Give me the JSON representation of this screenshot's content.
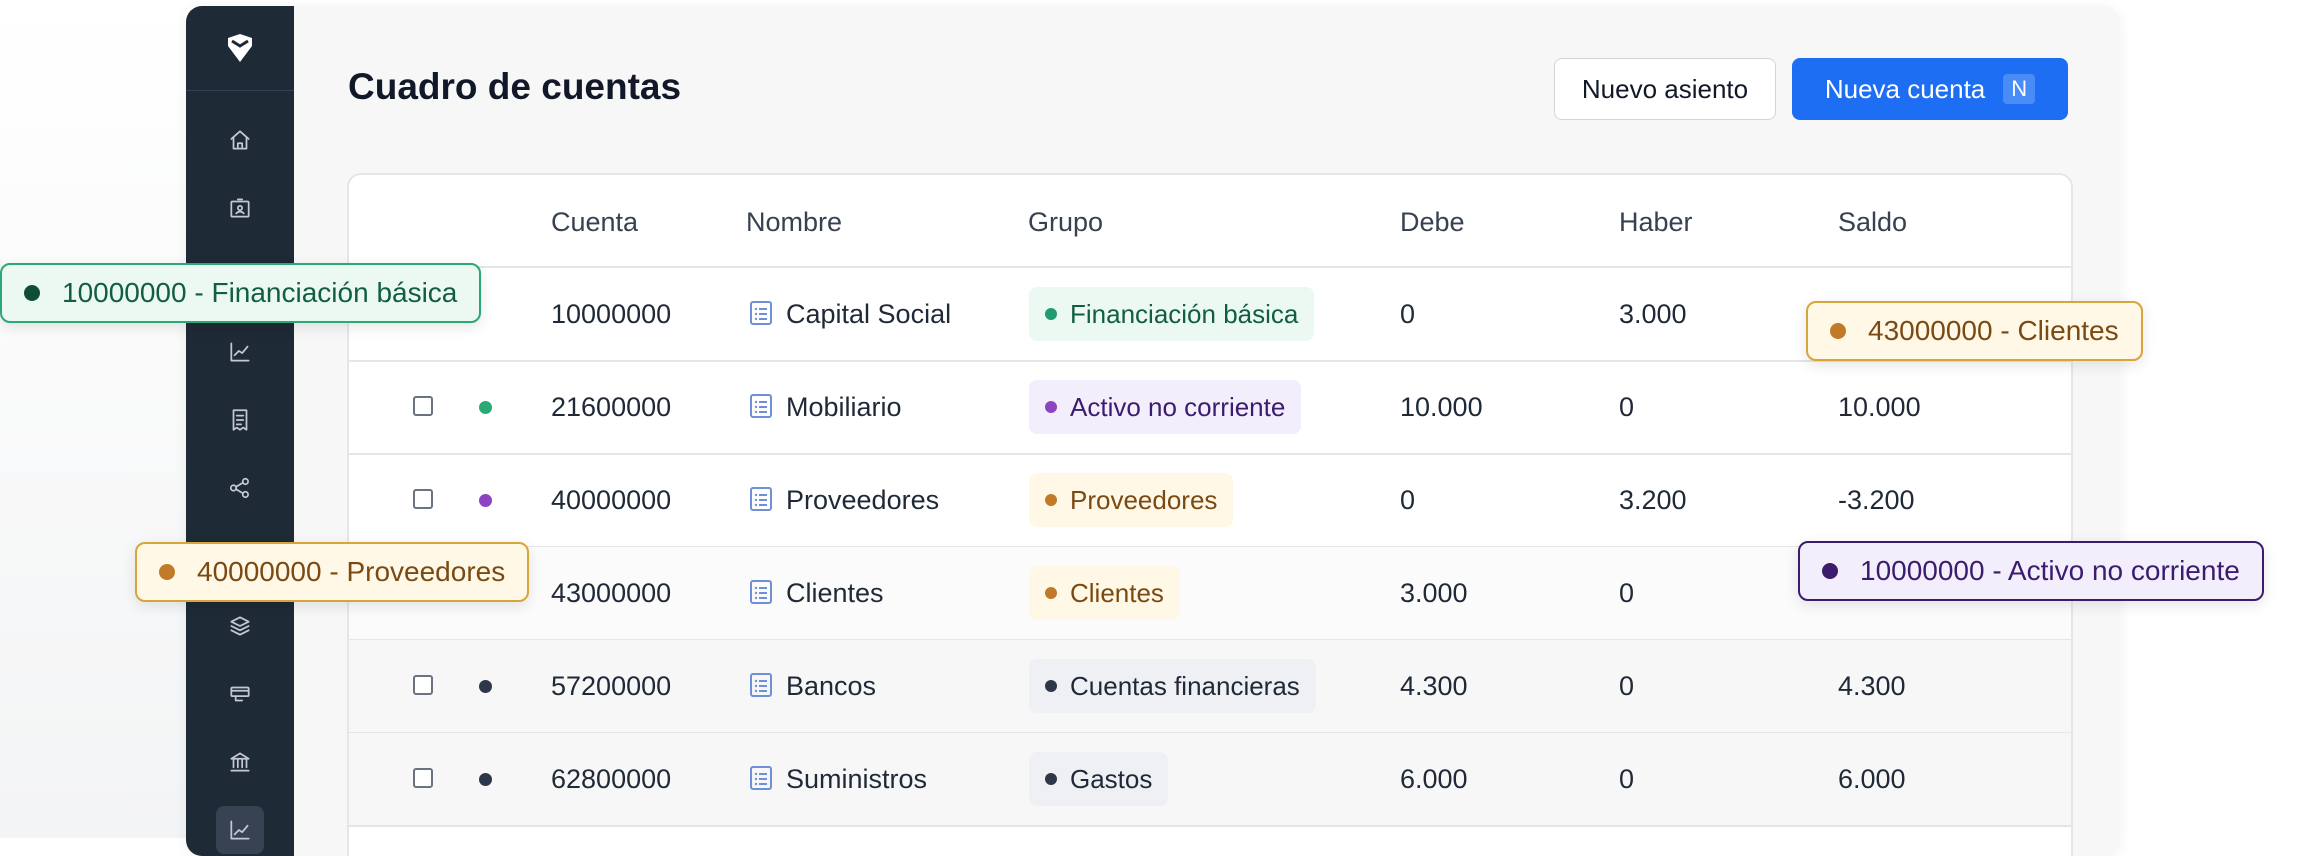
{
  "page": {
    "title": "Cuadro de cuentas",
    "secondary_button": "Nuevo asiento",
    "primary_button": "Nueva cuenta",
    "primary_button_shortcut": "N"
  },
  "sidebar": {
    "icons": [
      "logo-icon",
      "home-icon",
      "contact-card-icon",
      "chart-icon",
      "receipt-icon",
      "share-icon",
      "layers-icon",
      "cards-icon",
      "bank-icon",
      "trend-icon"
    ]
  },
  "table": {
    "columns": [
      "Cuenta",
      "Nombre",
      "Grupo",
      "Debe",
      "Haber",
      "Saldo"
    ],
    "rows": [
      {
        "cuenta": "10000000",
        "nombre": "Capital Social",
        "grupo": "Financiación básica",
        "debe": "0",
        "haber": "3.000",
        "saldo": "",
        "dot_color": "",
        "group_color": "green"
      },
      {
        "cuenta": "21600000",
        "nombre": "Mobiliario",
        "grupo": "Activo no corriente",
        "debe": "10.000",
        "haber": "0",
        "saldo": "10.000",
        "dot_color": "#2aa876",
        "group_color": "purple"
      },
      {
        "cuenta": "40000000",
        "nombre": "Proveedores",
        "grupo": "Proveedores",
        "debe": "0",
        "haber": "3.200",
        "saldo": "-3.200",
        "dot_color": "#8e44c2",
        "group_color": "amber"
      },
      {
        "cuenta": "43000000",
        "nombre": "Clientes",
        "grupo": "Clientes",
        "debe": "3.000",
        "haber": "0",
        "saldo": "",
        "dot_color": "",
        "group_color": "amber"
      },
      {
        "cuenta": "57200000",
        "nombre": "Bancos",
        "grupo": "Cuentas financieras",
        "debe": "4.300",
        "haber": "0",
        "saldo": "4.300",
        "dot_color": "#2d3748",
        "group_color": "gray"
      },
      {
        "cuenta": "62800000",
        "nombre": "Suministros",
        "grupo": "Gastos",
        "debe": "6.000",
        "haber": "0",
        "saldo": "6.000",
        "dot_color": "#2d3748",
        "group_color": "gray"
      }
    ]
  },
  "tooltips": [
    {
      "text": "10000000 - Financiación básica",
      "color": "green"
    },
    {
      "text": "43000000 - Clientes",
      "color": "amber"
    },
    {
      "text": "40000000 - Proveedores",
      "color": "amber"
    },
    {
      "text": "10000000 - Activo no corriente",
      "color": "purple"
    }
  ],
  "colors": {
    "green": {
      "bg": "#ecf9f3",
      "fg": "#115e42",
      "dot": "#1f9d6c",
      "border": "#2aa876"
    },
    "purple": {
      "bg": "#f3eefc",
      "fg": "#3b1c6e",
      "dot": "#8e44c2",
      "border": "#3b1c6e"
    },
    "amber": {
      "bg": "#fff8e6",
      "fg": "#7a4a12",
      "dot": "#c07a28",
      "border": "#d6a53c"
    },
    "gray": {
      "bg": "#eef0f3",
      "fg": "#1f2937",
      "dot": "#2d3748",
      "border": "#9ca3af"
    },
    "accent": "#1d6ef2",
    "sidebar": "#1f2a37"
  }
}
